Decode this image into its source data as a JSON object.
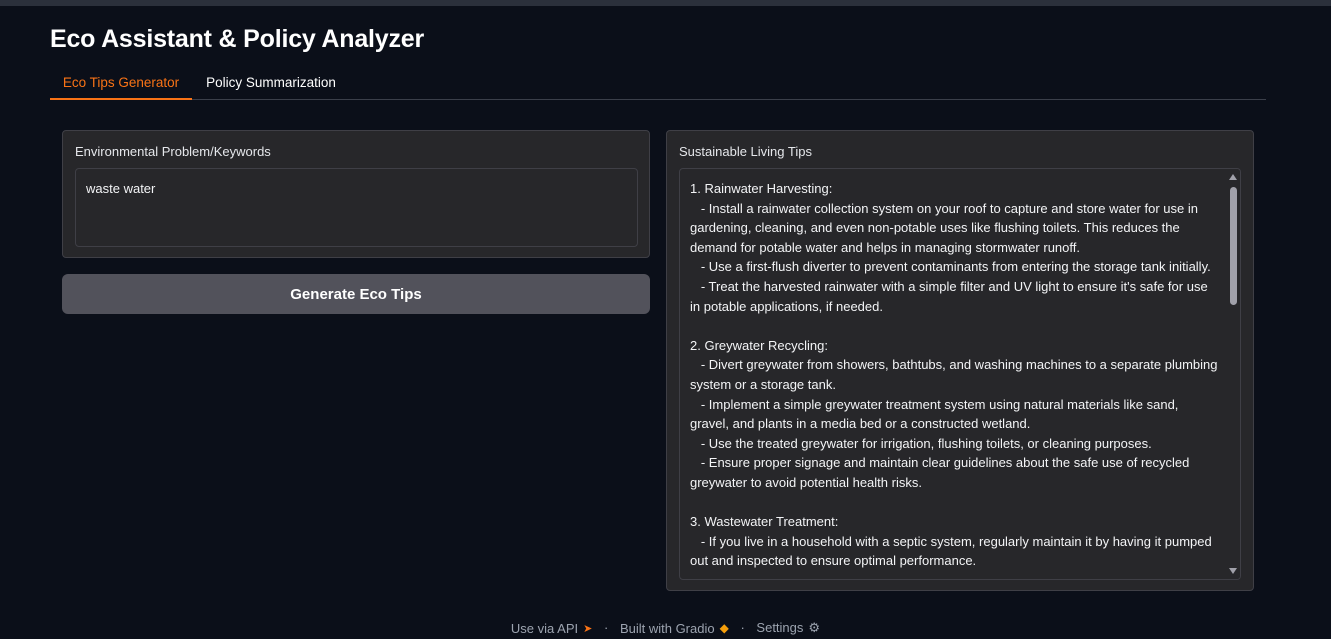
{
  "app": {
    "title": "Eco Assistant & Policy Analyzer"
  },
  "tabs": [
    {
      "label": "Eco Tips Generator",
      "active": true
    },
    {
      "label": "Policy Summarization",
      "active": false
    }
  ],
  "input_panel": {
    "label": "Environmental Problem/Keywords",
    "value": "waste water"
  },
  "generate_button": {
    "label": "Generate Eco Tips"
  },
  "output_panel": {
    "label": "Sustainable Living Tips",
    "text": "1. Rainwater Harvesting:\n   - Install a rainwater collection system on your roof to capture and store water for use in gardening, cleaning, and even non-potable uses like flushing toilets. This reduces the demand for potable water and helps in managing stormwater runoff.\n   - Use a first-flush diverter to prevent contaminants from entering the storage tank initially.\n   - Treat the harvested rainwater with a simple filter and UV light to ensure it's safe for use in potable applications, if needed.\n\n2. Greywater Recycling:\n   - Divert greywater from showers, bathtubs, and washing machines to a separate plumbing system or a storage tank.\n   - Implement a simple greywater treatment system using natural materials like sand, gravel, and plants in a media bed or a constructed wetland.\n   - Use the treated greywater for irrigation, flushing toilets, or cleaning purposes.\n   - Ensure proper signage and maintain clear guidelines about the safe use of recycled greywater to avoid potential health risks.\n\n3. Wastewater Treatment:\n   - If you live in a household with a septic system, regularly maintain it by having it pumped out and inspected to ensure optimal performance."
  },
  "footer": {
    "api_label": "Use via API",
    "gradio_label": "Built with Gradio",
    "settings_label": "Settings",
    "separator": "·"
  },
  "colors": {
    "background": "#0b0f19",
    "panel": "#27272a",
    "accent": "#f97316",
    "button": "#52525b"
  }
}
